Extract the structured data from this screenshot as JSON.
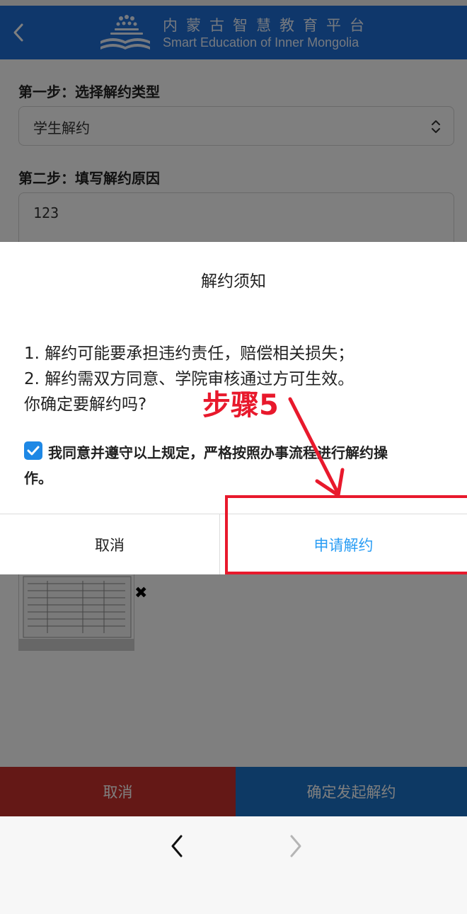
{
  "header": {
    "title_cn": "内蒙古智慧教育平台",
    "title_en": "Smart Education of Inner Mongolia",
    "back_icon": "chevron-left-icon"
  },
  "form": {
    "step1_label": "第一步：选择解约类型",
    "termination_type": "学生解约",
    "step2_label": "第二步：填写解约原因",
    "reason_value": "123"
  },
  "attachment": {
    "remove_symbol": "✖"
  },
  "bottom_bar": {
    "cancel_label": "取消",
    "confirm_label": "确定发起解约"
  },
  "dialog": {
    "title": "解约须知",
    "line1": "1. 解约可能要承担违约责任，赔偿相关损失；",
    "line2": "2. 解约需双方同意、学院审核通过方可生效。",
    "line3": "你确定要解约吗?",
    "agree_text_line1": "我同意并遵守以上规定，严格按照办事流程进行解约操",
    "agree_text_line2": "作。",
    "agree_checked": true,
    "cancel_label": "取消",
    "apply_label": "申请解约"
  },
  "annotation": {
    "step_label": "步骤5",
    "color": "#e8192c"
  },
  "colors": {
    "header_blue": "#1f6fd6",
    "link_blue": "#2a9df4",
    "cancel_red": "#c9302c",
    "confirm_blue": "#1a73c9"
  }
}
